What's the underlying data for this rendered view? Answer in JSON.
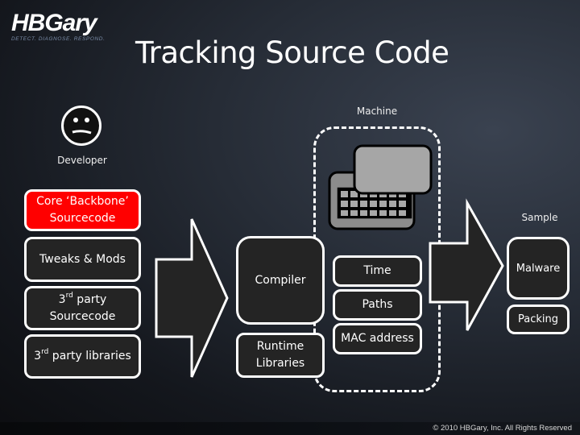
{
  "logo": {
    "name": "HBGary",
    "tagline": "DETECT. DIAGNOSE. RESPOND."
  },
  "title": "Tracking Source Code",
  "developer": {
    "label": "Developer",
    "icon": "sad-face-icon"
  },
  "machine": {
    "label": "Machine",
    "icon": "computer-icon"
  },
  "sample": {
    "label": "Sample"
  },
  "source_boxes": [
    {
      "line1": "Core ‘Backbone’",
      "line2": "Sourcecode",
      "highlight_color": "#ff0000"
    },
    {
      "line1": "Tweaks & Mods"
    },
    {
      "pre": "3",
      "sup": "rd",
      "line1": " party",
      "line2": "Sourcecode"
    },
    {
      "pre": "3",
      "sup": "rd",
      "line1": " party libraries"
    }
  ],
  "build_boxes": [
    {
      "label": "Compiler"
    },
    {
      "line1": "Runtime",
      "line2": "Libraries"
    }
  ],
  "artifacts": [
    {
      "label": "Time"
    },
    {
      "label": "Paths"
    },
    {
      "label": "MAC address"
    }
  ],
  "sample_boxes": [
    {
      "label": "Malware"
    },
    {
      "label": "Packing"
    }
  ],
  "footer": {
    "copyright": "© 2010 HBGary, Inc. All Rights Reserved"
  }
}
